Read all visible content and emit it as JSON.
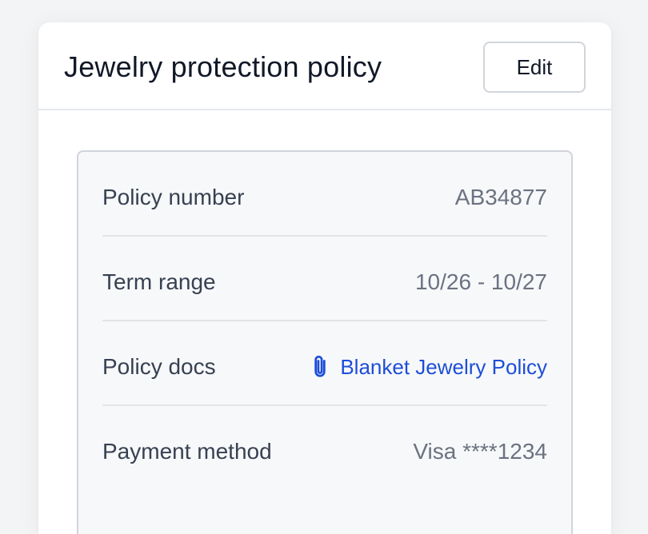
{
  "card": {
    "title": "Jewelry protection policy",
    "edit_label": "Edit"
  },
  "details": [
    {
      "label": "Policy number",
      "value": "AB34877"
    },
    {
      "label": "Term range",
      "value": "10/26 - 10/27"
    },
    {
      "label": "Policy docs",
      "value": "Blanket Jewelry Policy",
      "icon": "paperclip-icon"
    },
    {
      "label": "Payment method",
      "value": "Visa ****1234"
    }
  ],
  "colors": {
    "link": "#1d4ed8",
    "label_text": "#374151",
    "value_text": "#6b7280",
    "panel_background": "#f7f8fa"
  }
}
